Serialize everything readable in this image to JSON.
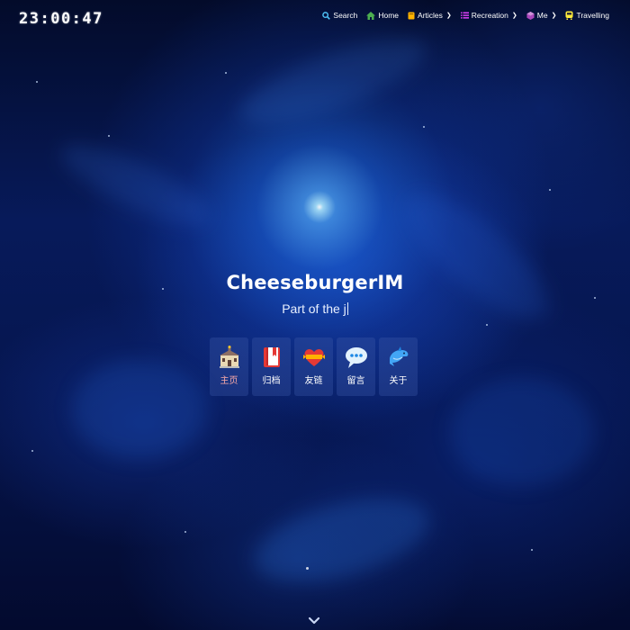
{
  "clock": {
    "time": "23:00:47"
  },
  "nav": {
    "items": [
      {
        "label": "Search",
        "icon": "search-icon",
        "has_dropdown": false
      },
      {
        "label": "Home",
        "icon": "home-icon",
        "has_dropdown": false
      },
      {
        "label": "Articles",
        "icon": "book-icon",
        "has_dropdown": true
      },
      {
        "label": "Recreation",
        "icon": "list-icon",
        "has_dropdown": true
      },
      {
        "label": "Me",
        "icon": "cube-icon",
        "has_dropdown": true
      },
      {
        "label": "Travelling",
        "icon": "train-icon",
        "has_dropdown": false
      }
    ]
  },
  "hero": {
    "title": "CheeseburgerIM",
    "subtitle": "Part of the j"
  },
  "quick_links": [
    {
      "label": "主页",
      "icon": "building-icon",
      "active": true
    },
    {
      "label": "归档",
      "icon": "bookmark-book-icon",
      "active": false
    },
    {
      "label": "友链",
      "icon": "heart-ribbon-icon",
      "active": false
    },
    {
      "label": "留言",
      "icon": "speech-bubble-icon",
      "active": false
    },
    {
      "label": "关于",
      "icon": "dolphin-icon",
      "active": false
    }
  ],
  "colors": {
    "background": "#071a5a",
    "active_link": "#f7a8a8",
    "search_icon": "#4fc3f7",
    "home_icon": "#4caf50",
    "articles_icon": "#ffb300",
    "recreation_icon": "#e040fb",
    "me_icon": "#ab47bc",
    "travelling_icon": "#ffeb3b"
  }
}
